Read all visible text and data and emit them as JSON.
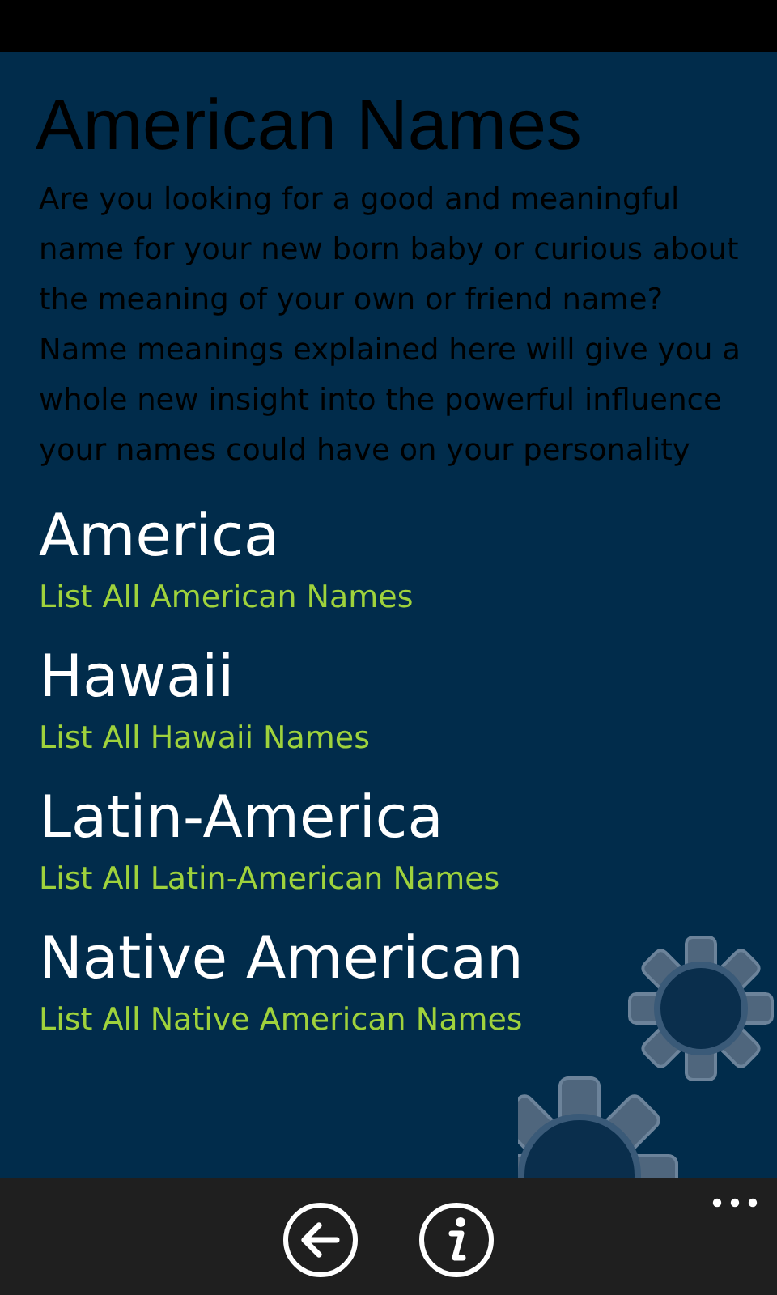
{
  "page": {
    "title": "American Names",
    "description": "Are you looking for a good and meaningful name for your new born baby or curious about the meaning of your own or friend name? Name meanings explained here will give you a whole new insight into the powerful influence your names could have on your personality"
  },
  "items": [
    {
      "name": "America",
      "subtitle": "List All American Names"
    },
    {
      "name": "Hawaii",
      "subtitle": "List All Hawaii Names"
    },
    {
      "name": "Latin-America",
      "subtitle": "List All Latin-American Names"
    },
    {
      "name": "Native American",
      "subtitle": "List All Native American Names"
    }
  ],
  "app_bar": {
    "buttons": [
      {
        "kind": "back"
      },
      {
        "kind": "info"
      }
    ]
  }
}
